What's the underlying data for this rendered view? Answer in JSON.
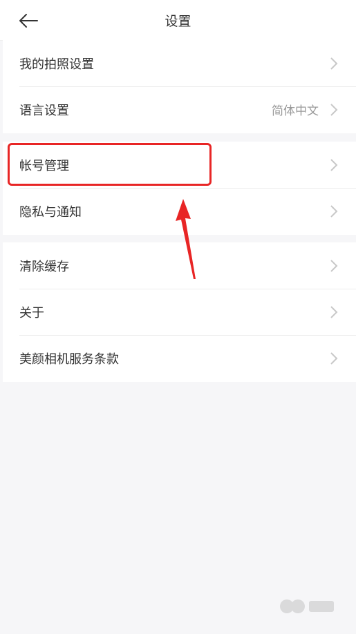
{
  "header": {
    "title": "设置",
    "back_icon": "back-arrow-icon"
  },
  "groups": [
    {
      "items": [
        {
          "label": "我的拍照设置",
          "value": ""
        },
        {
          "label": "语言设置",
          "value": "简体中文"
        }
      ]
    },
    {
      "items": [
        {
          "label": "帐号管理",
          "value": ""
        },
        {
          "label": "隐私与通知",
          "value": ""
        }
      ]
    },
    {
      "items": [
        {
          "label": "清除缓存",
          "value": ""
        },
        {
          "label": "关于",
          "value": ""
        },
        {
          "label": "美颜相机服务条款",
          "value": ""
        }
      ]
    }
  ],
  "annotation": {
    "highlight_color": "#e82525",
    "highlight_target": "帐号管理"
  },
  "colors": {
    "background": "#f6f6f8",
    "chevron": "#c8c8c8"
  }
}
